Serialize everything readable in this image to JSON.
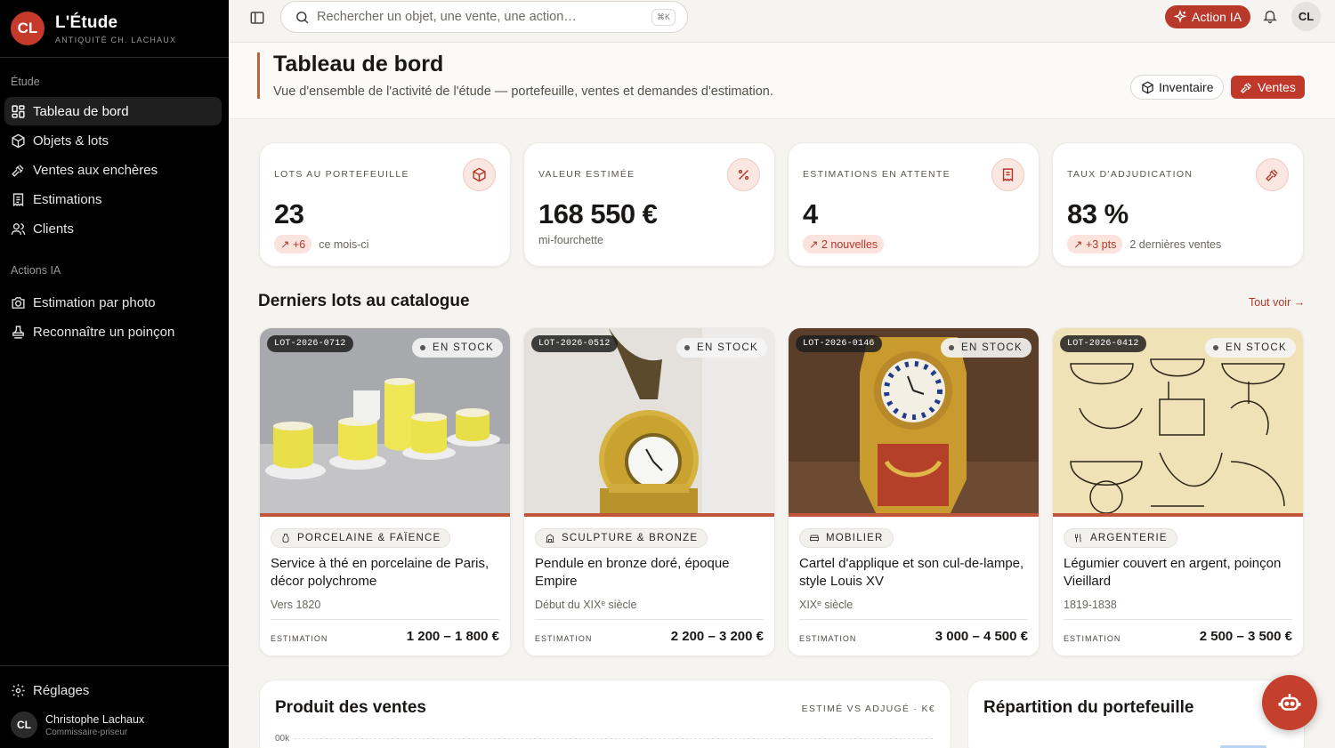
{
  "brand": {
    "initials": "CL",
    "name": "L'Étude",
    "subtitle": "ANTIQUITÉ CH. LACHAUX"
  },
  "sidebar": {
    "section1": "Étude",
    "items": [
      {
        "label": "Tableau de bord",
        "icon": "dashboard-icon",
        "active": true
      },
      {
        "label": "Objets & lots",
        "icon": "box-icon"
      },
      {
        "label": "Ventes aux enchères",
        "icon": "gavel-icon"
      },
      {
        "label": "Estimations",
        "icon": "receipt-icon"
      },
      {
        "label": "Clients",
        "icon": "users-icon"
      }
    ],
    "section2": "Actions IA",
    "ai_items": [
      {
        "label": "Estimation par photo",
        "icon": "camera-icon"
      },
      {
        "label": "Reconnaître un poinçon",
        "icon": "stamp-icon"
      }
    ],
    "settings_label": "Réglages",
    "user": {
      "initials": "CL",
      "name": "Christophe Lachaux",
      "role": "Commissaire-priseur"
    }
  },
  "topbar": {
    "search_placeholder": "Rechercher un objet, une vente, une action…",
    "shortcut": "⌘K",
    "ai_button": "Action IA",
    "avatar": "CL"
  },
  "header": {
    "title": "Tableau de bord",
    "subtitle": "Vue d'ensemble de l'activité de l'étude — portefeuille, ventes et demandes d'estimation.",
    "inventory_button": "Inventaire",
    "sales_button": "Ventes"
  },
  "kpis": [
    {
      "label": "LOTS AU PORTEFEUILLE",
      "value": "23",
      "pill": "↗ +6",
      "note": "ce mois-ci"
    },
    {
      "label": "VALEUR ESTIMÉE",
      "value": "168 550 €",
      "pill": "",
      "note": "mi-fourchette"
    },
    {
      "label": "ESTIMATIONS EN ATTENTE",
      "value": "4",
      "pill": "↗ 2 nouvelles",
      "note": ""
    },
    {
      "label": "TAUX D'ADJUDICATION",
      "value": "83 %",
      "pill": "↗ +3 pts",
      "note": "2 dernières ventes"
    }
  ],
  "catalogue": {
    "title": "Derniers lots au catalogue",
    "see_all": "Tout voir →",
    "lots": [
      {
        "ref": "LOT-2026-0712",
        "status": "EN STOCK",
        "category": "PORCELAINE & FAÏENCE",
        "name": "Service à thé en porcelaine de Paris, décor polychrome",
        "date": "Vers 1820",
        "est_label": "ESTIMATION",
        "estimate": "1 200 – 1 800 €"
      },
      {
        "ref": "LOT-2026-0512",
        "status": "EN STOCK",
        "category": "SCULPTURE & BRONZE",
        "name": "Pendule en bronze doré, époque Empire",
        "date": "Début du XIXᵉ siècle",
        "est_label": "ESTIMATION",
        "estimate": "2 200 – 3 200 €"
      },
      {
        "ref": "LOT-2026-0146",
        "status": "EN STOCK",
        "category": "MOBILIER",
        "name": "Cartel d'applique et son cul-de-lampe, style Louis XV",
        "date": "XIXᵉ siècle",
        "est_label": "ESTIMATION",
        "estimate": "3 000 – 4 500 €"
      },
      {
        "ref": "LOT-2026-0412",
        "status": "EN STOCK",
        "category": "ARGENTERIE",
        "name": "Légumier couvert en argent, poinçon Vieillard",
        "date": "1819-1838",
        "est_label": "ESTIMATION",
        "estimate": "2 500 – 3 500 €"
      }
    ]
  },
  "sales_card": {
    "title": "Produit des ventes",
    "meta": "ESTIMÉ VS ADJUGÉ · K€",
    "tick": "00k"
  },
  "portfolio_card": {
    "title": "Répartition du portefeuille"
  },
  "colors": {
    "accent": "#c0382a",
    "sidebar": "#000000"
  }
}
